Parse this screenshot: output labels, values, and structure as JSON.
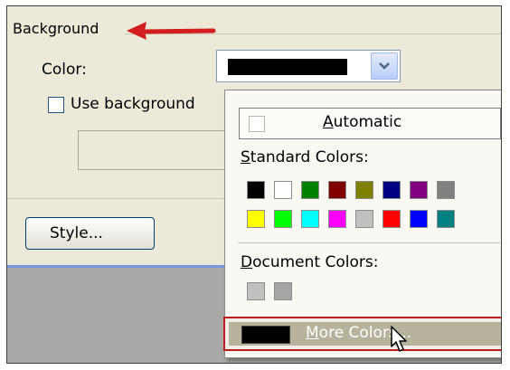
{
  "section": {
    "title": "Background"
  },
  "color_field": {
    "label": "Color:",
    "current_color": "#000000"
  },
  "use_background": {
    "label": "Use background"
  },
  "style_button": {
    "label": "Style..."
  },
  "popup": {
    "automatic": {
      "prefix": "",
      "accel": "A",
      "rest": "utomatic"
    },
    "standard": {
      "accel": "S",
      "rest": "tandard Colors:"
    },
    "standard_colors": [
      [
        "#000000",
        "#ffffff",
        "#008000",
        "#800000",
        "#808000",
        "#000080",
        "#800080",
        "#808080"
      ],
      [
        "#ffff00",
        "#00ff00",
        "#00ffff",
        "#ff00ff",
        "#c0c0c0",
        "#ff0000",
        "#0000ff",
        "#008080"
      ]
    ],
    "document": {
      "accel": "D",
      "rest": "ocument Colors:"
    },
    "document_colors": [
      "#c0c0c0",
      "#a6a6a6"
    ],
    "more": {
      "accel": "M",
      "rest": "ore Colors..."
    }
  },
  "icons": [
    "dropdown-chevron-icon",
    "mouse-cursor-icon",
    "red-arrow-icon"
  ],
  "colors": {
    "highlight_border": "#c11b1b",
    "annotation_arrow": "#d21e1e"
  }
}
